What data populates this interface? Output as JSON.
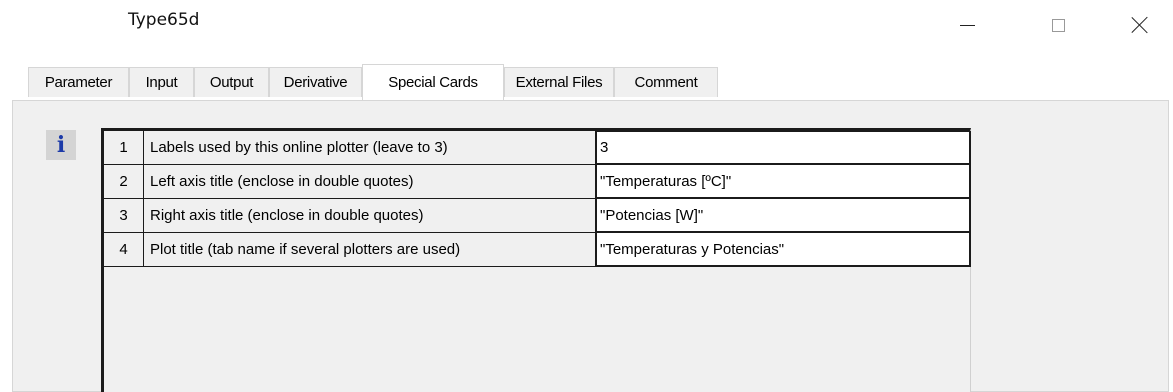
{
  "window": {
    "title": "Type65d",
    "minimize_icon": "minimize-icon",
    "maximize_icon": "maximize-icon",
    "close_icon": "close-icon"
  },
  "tabs": [
    {
      "label": "Parameter",
      "active": false
    },
    {
      "label": "Input",
      "active": false
    },
    {
      "label": "Output",
      "active": false
    },
    {
      "label": "Derivative",
      "active": false
    },
    {
      "label": "Special Cards",
      "active": true
    },
    {
      "label": "External Files",
      "active": false
    },
    {
      "label": "Comment",
      "active": false
    }
  ],
  "info_icon": {
    "glyph": "i",
    "icon": "info-icon",
    "color": "#1c3aa8"
  },
  "grid": {
    "rows": [
      {
        "index": "1",
        "label": "Labels used by this online plotter (leave to 3)",
        "value": "3"
      },
      {
        "index": "2",
        "label": "Left axis title (enclose in double quotes)",
        "value": "\"Temperaturas [ºC]\""
      },
      {
        "index": "3",
        "label": "Right axis title (enclose in double quotes)",
        "value": "\"Potencias [W]\""
      },
      {
        "index": "4",
        "label": "Plot title (tab name if several plotters are used)",
        "value": "\"Temperaturas y Potencias\""
      }
    ]
  }
}
